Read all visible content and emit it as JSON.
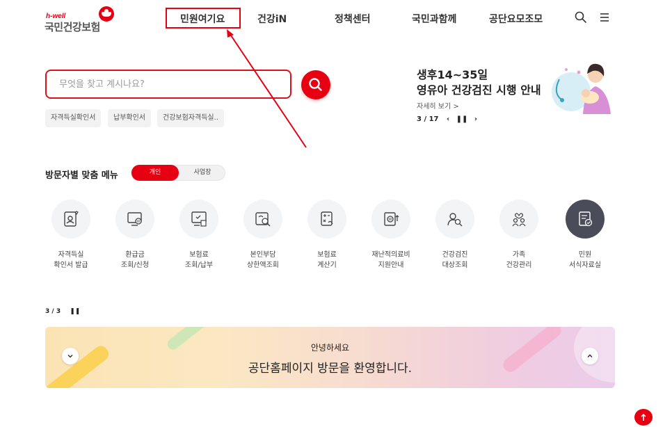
{
  "header": {
    "logo_sub": "h-well",
    "logo_name": "국민건강보험",
    "nav": [
      "민원여기요",
      "건강iN",
      "정책센터",
      "국민과함께",
      "공단요모조모"
    ]
  },
  "search": {
    "placeholder": "무엇을 찾고 계시나요?",
    "chips": [
      "자격득실확인서",
      "납부확인서",
      "건강보험자격득실.."
    ]
  },
  "banner": {
    "title_line1": "생후14~35일",
    "title_line2": "영유아 건강검진 시행 안내",
    "more": "자세히 보기 >",
    "pager": "3 / 17"
  },
  "menu": {
    "title": "방문자별 맞춤 메뉴",
    "toggle_on": "개인",
    "toggle_off": "사업장",
    "items": [
      {
        "label": "자격득실\n확인서 발급",
        "icon": "id-card-icon"
      },
      {
        "label": "환급금\n조회/신청",
        "icon": "monitor-won-icon"
      },
      {
        "label": "보험료\n조회/납부",
        "icon": "bill-icon"
      },
      {
        "label": "본인부담\n상한액조회",
        "icon": "search-card-icon"
      },
      {
        "label": "보험료\n계산기",
        "icon": "calculator-icon"
      },
      {
        "label": "재난적의료비\n지원안내",
        "icon": "medical-support-icon"
      },
      {
        "label": "건강검진\n대상조회",
        "icon": "people-search-icon"
      },
      {
        "label": "가족\n건강관리",
        "icon": "family-icon"
      },
      {
        "label": "민원\n서식자료실",
        "icon": "document-check-icon"
      }
    ]
  },
  "promo": {
    "pager": "3 / 3",
    "line1": "안녕하세요",
    "line2": "공단홈페이지 방문을 환영합니다."
  },
  "colors": {
    "brand_red": "#e60012",
    "dark_icon_bg": "#4a4c5a"
  }
}
